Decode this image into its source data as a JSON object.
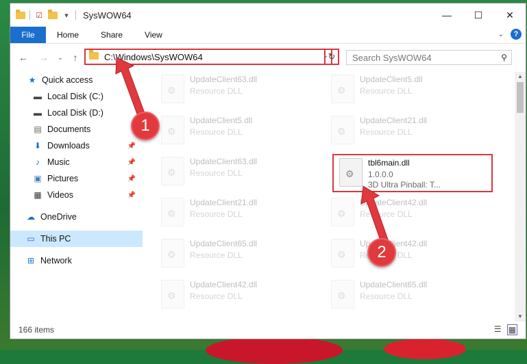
{
  "window": {
    "title": "SysWOW64"
  },
  "ribbon": {
    "tabs": [
      "File",
      "Home",
      "Share",
      "View"
    ],
    "help_label": "?"
  },
  "address": {
    "path": "C:\\Windows\\SysWOW64",
    "search_placeholder": "Search SysWOW64"
  },
  "sidebar": {
    "items": [
      {
        "label": "Quick access",
        "icon": "star-icon"
      },
      {
        "label": "Local Disk (C:)",
        "icon": "drive-icon"
      },
      {
        "label": "Local Disk (D:)",
        "icon": "drive-icon"
      },
      {
        "label": "Documents",
        "icon": "documents-icon"
      },
      {
        "label": "Downloads",
        "icon": "download-icon"
      },
      {
        "label": "Music",
        "icon": "music-icon"
      },
      {
        "label": "Pictures",
        "icon": "pictures-icon"
      },
      {
        "label": "Videos",
        "icon": "videos-icon"
      },
      {
        "label": "OneDrive",
        "icon": "cloud-icon"
      },
      {
        "label": "This PC",
        "icon": "computer-icon"
      },
      {
        "label": "Network",
        "icon": "network-icon"
      }
    ]
  },
  "files": [
    {
      "name": "UpdateClient63.dll",
      "desc": "Resource DLL"
    },
    {
      "name": "UpdateClient5.dll",
      "desc": "Resource DLL"
    },
    {
      "name": "UpdateClient5.dll",
      "desc": "Resource DLL"
    },
    {
      "name": "UpdateClient21.dll",
      "desc": "Resource DLL"
    },
    {
      "name": "UpdateClient63.dll",
      "desc": "Resource DLL"
    },
    {
      "name": "tbl6main.dll",
      "version": "1.0.0.0",
      "desc": "3D Ultra Pinball: T..."
    },
    {
      "name": "UpdateClient21.dll",
      "desc": "Resource DLL"
    },
    {
      "name": "UpdateClient42.dll",
      "desc": "Resource DLL"
    },
    {
      "name": "UpdateClient65.dll",
      "desc": "Resource DLL"
    },
    {
      "name": "UpdateClient42.dll",
      "desc": "Resource DLL"
    },
    {
      "name": "UpdateClient42.dll",
      "desc": "Resource DLL"
    },
    {
      "name": "UpdateClient65.dll",
      "desc": "Resource DLL"
    }
  ],
  "status": {
    "item_count": "166 items"
  },
  "callouts": {
    "one": "1",
    "two": "2"
  },
  "colors": {
    "accent": "#1a6fce",
    "highlight": "#d9363e",
    "selection": "#cce8ff"
  }
}
